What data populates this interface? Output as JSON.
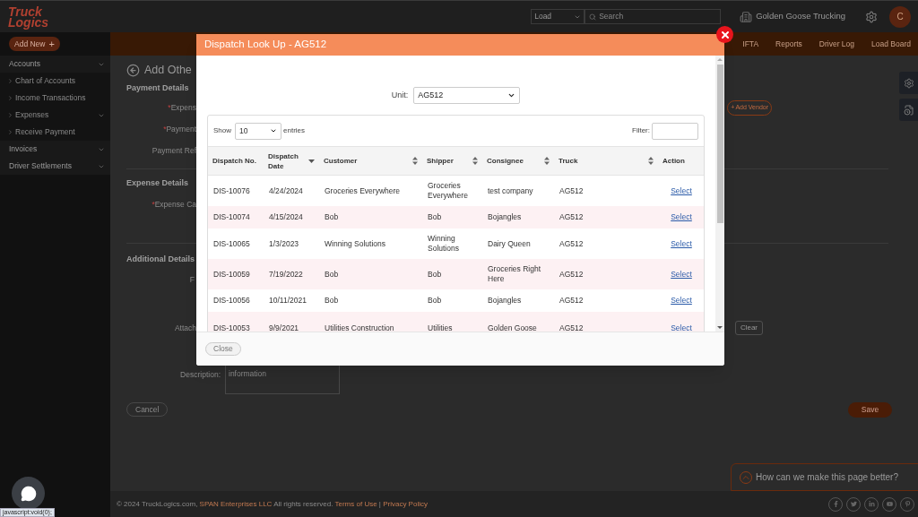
{
  "topbar": {
    "logo_top": "Truck",
    "logo_bottom": "Logics",
    "search_scope": "Load",
    "search_placeholder": "Search",
    "company": "Golden Goose Trucking",
    "avatar": "C"
  },
  "sidebar": {
    "add_new": "Add New",
    "add_symbol": "+",
    "items": [
      {
        "kind": "group",
        "label": "Accounts",
        "expandable": true
      },
      {
        "kind": "link",
        "label": "Chart of Accounts",
        "expandable": false
      },
      {
        "kind": "link",
        "label": "Income Transactions",
        "expandable": false
      },
      {
        "kind": "link",
        "label": "Expenses",
        "expandable": true
      },
      {
        "kind": "link",
        "label": "Receive Payment",
        "expandable": false
      },
      {
        "kind": "group",
        "label": "Invoices",
        "expandable": true
      },
      {
        "kind": "group",
        "label": "Driver Settlements",
        "expandable": true
      }
    ]
  },
  "nav": [
    "IFTA",
    "Reports",
    "Driver Log",
    "Load Board"
  ],
  "form": {
    "title": "Add Othe",
    "payment_heading": "Payment Details",
    "payment_labels": [
      {
        "mark": "*",
        "text": "Expens"
      },
      {
        "mark": "*",
        "text": "Payment"
      },
      {
        "text": "Payment Ref"
      }
    ],
    "add_vendor": "Add Vendor",
    "add_vendor_symbol": "+",
    "expense_heading": "Expense Details",
    "expense_labels": [
      {
        "mark": "*",
        "text": "Expense Ca"
      }
    ],
    "additional_heading": "Additional Details",
    "additional_label": "F",
    "attach_label": "Attach",
    "clear": "Clear",
    "description_label": "Description:",
    "description_value": "information",
    "cancel": "Cancel",
    "save": "Save"
  },
  "dialog": {
    "title": "Dispatch Look Up - AG512",
    "unit_label": "Unit:",
    "unit_value": "AG512",
    "show_label": "Show",
    "page_size": "10",
    "entries_label": "entries",
    "filter_label": "Filter:",
    "columns": [
      {
        "label": "Dispatch No.",
        "kind": "plain"
      },
      {
        "label": "Dispatch Date",
        "kind": "sorted"
      },
      {
        "label": "Customer",
        "kind": "sortable"
      },
      {
        "label": "Shipper",
        "kind": "sortable"
      },
      {
        "label": "Consignee",
        "kind": "sortable"
      },
      {
        "label": "Truck",
        "kind": "sortable"
      },
      {
        "label": "Action",
        "kind": "plain"
      }
    ],
    "rows": [
      [
        "DIS-10076",
        "4/24/2024",
        "Groceries Everywhere",
        "Groceries Everywhere",
        "test company",
        "AG512",
        "Select"
      ],
      [
        "DIS-10074",
        "4/15/2024",
        "Bob",
        "Bob",
        "Bojangles",
        "AG512",
        "Select"
      ],
      [
        "DIS-10065",
        "1/3/2023",
        "Winning Solutions",
        "Winning Solutions",
        "Dairy Queen",
        "AG512",
        "Select"
      ],
      [
        "DIS-10059",
        "7/19/2022",
        "Bob",
        "Bob",
        "Groceries Right Here",
        "AG512",
        "Select"
      ],
      [
        "DIS-10056",
        "10/11/2021",
        "Bob",
        "Bob",
        "Bojangles",
        "AG512",
        "Select"
      ],
      [
        "DIS-10053",
        "9/9/2021",
        "Utilities Construction",
        "Utilities",
        "Golden Goose",
        "AG512",
        "Select"
      ]
    ],
    "close": "Close"
  },
  "footer": {
    "copyright": "© 2024 TruckLogics.com, ",
    "company_link": "SPAN Enterprises LLC",
    "rights": " All rights reserved. ",
    "terms": "Terms of Use",
    "separator": " | ",
    "privacy": "Privacy Policy"
  },
  "feedback": "How can we make this page better?",
  "status_url": "javascript:void(0);"
}
